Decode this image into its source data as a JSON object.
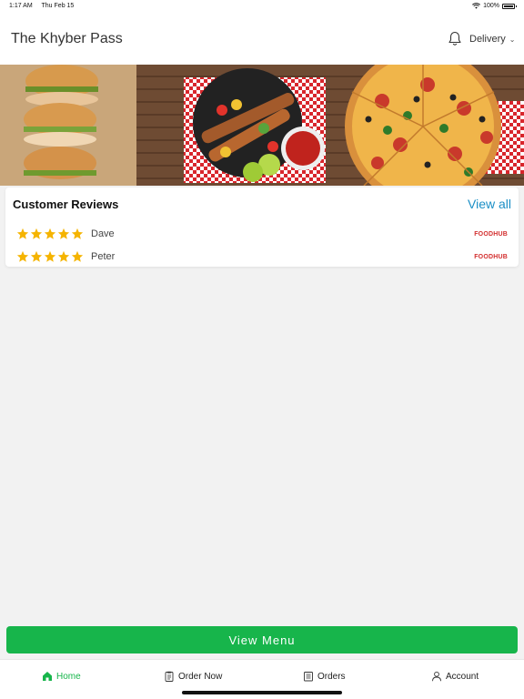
{
  "status_bar": {
    "time": "1:17 AM",
    "date": "Thu Feb 15",
    "battery": "100%"
  },
  "header": {
    "title": "The Khyber Pass",
    "order_mode": "Delivery"
  },
  "reviews": {
    "heading": "Customer Reviews",
    "view_all": "View all",
    "items": [
      {
        "name": "Dave",
        "rating": 5,
        "source": "FOODHUB"
      },
      {
        "name": "Peter",
        "rating": 5,
        "source": "FOODHUB"
      }
    ]
  },
  "view_menu": "View Menu",
  "tabs": [
    {
      "label": "Home",
      "icon": "home-icon",
      "active": true
    },
    {
      "label": "Order Now",
      "icon": "clipboard-icon",
      "active": false
    },
    {
      "label": "Orders",
      "icon": "receipt-icon",
      "active": false
    },
    {
      "label": "Account",
      "icon": "person-icon",
      "active": false
    }
  ],
  "colors": {
    "accent": "#17b54b",
    "link": "#1b8fc6",
    "star": "#f5b400",
    "source": "#d32f2f"
  }
}
